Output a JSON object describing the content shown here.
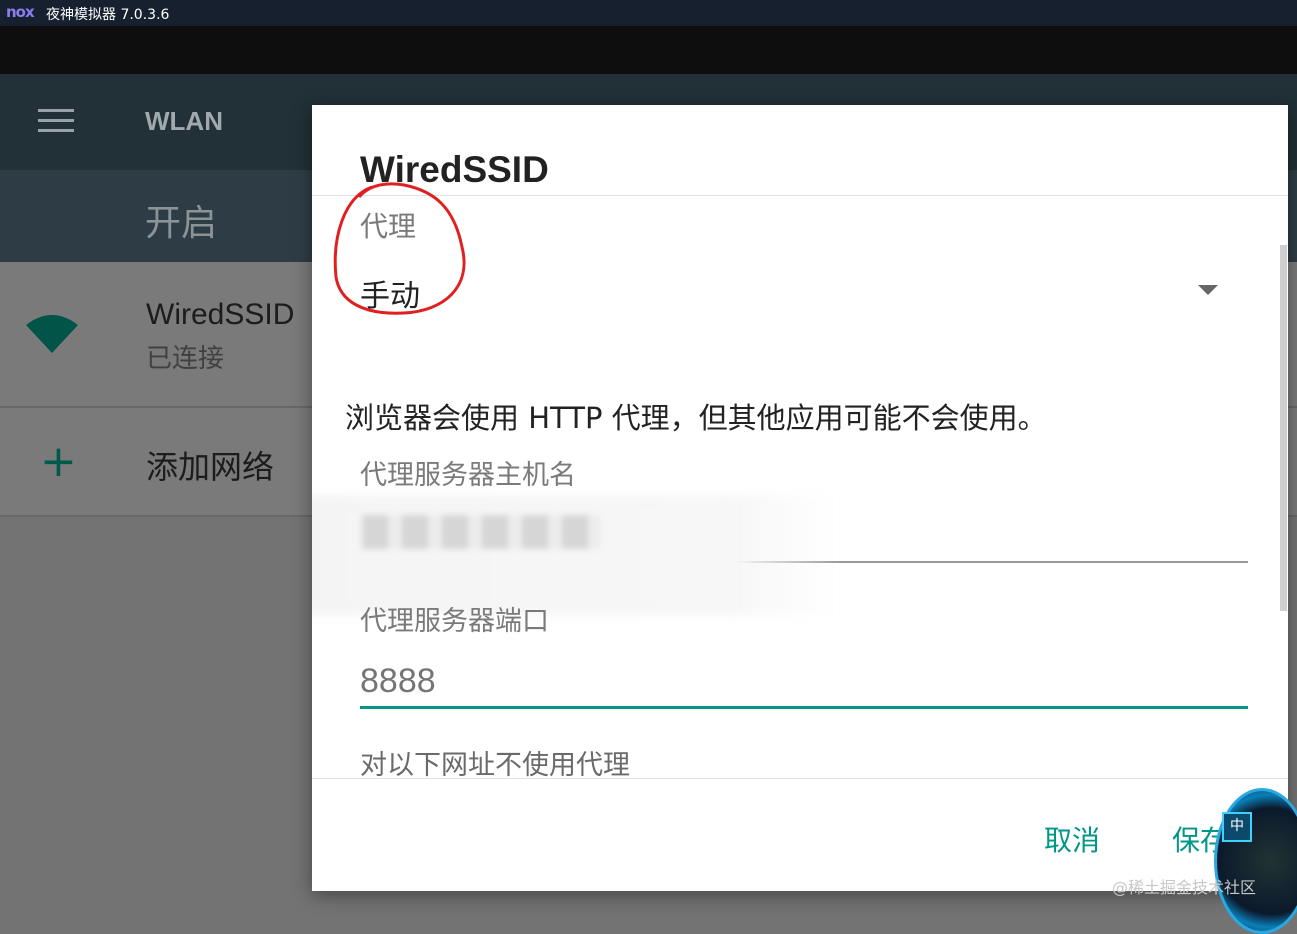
{
  "window": {
    "logo": "nox",
    "title": "夜神模拟器 7.0.3.6"
  },
  "appbar": {
    "title": "WLAN"
  },
  "switch": {
    "label": "开启"
  },
  "network": {
    "name": "WiredSSID",
    "status": "已连接"
  },
  "add_network": {
    "label": "添加网络"
  },
  "dialog": {
    "title": "WiredSSID",
    "proxy_label": "代理",
    "proxy_value": "手动",
    "note": "浏览器会使用 HTTP 代理，但其他应用可能不会使用。",
    "host_label": "代理服务器主机名",
    "port_label": "代理服务器端口",
    "port_placeholder": "8888",
    "bypass_label": "对以下网址不使用代理",
    "cancel_label": "取消",
    "save_label": "保存"
  },
  "watermark": "@稀土掘金技术社区",
  "badge": {
    "tag": "中"
  },
  "colors": {
    "accent": "#009688",
    "annotation": "#e02020"
  }
}
